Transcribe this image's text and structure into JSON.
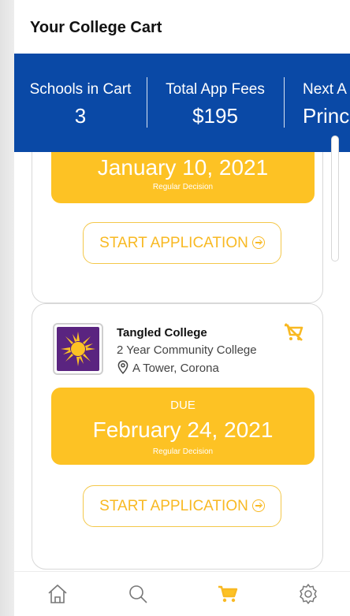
{
  "header": {
    "title": "Your College Cart"
  },
  "stats": [
    {
      "label": "Schools in Cart",
      "value": "3"
    },
    {
      "label": "Total App Fees",
      "value": "$195"
    },
    {
      "label": "Next A",
      "value": "Princ"
    }
  ],
  "cards": [
    {
      "due_date": "January 10, 2021",
      "decision": "Regular Decision",
      "button_label": "START APPLICATION"
    },
    {
      "school_name": "Tangled College",
      "school_type": "2 Year Community College",
      "location": "A Tower, Corona",
      "due_label": "DUE",
      "due_date": "February 24, 2021",
      "decision": "Regular Decision",
      "button_label": "START APPLICATION"
    }
  ],
  "colors": {
    "brand_blue": "#0a49a6",
    "accent_yellow": "#fdc224",
    "logo_purple": "#5a2480"
  },
  "icons": {
    "remove_cart": "remove-from-cart-icon",
    "location": "location-pin-icon",
    "start": "arrow-circle-right-icon",
    "nav": [
      "home-icon",
      "search-icon",
      "cart-icon",
      "settings-icon"
    ]
  },
  "nav": {
    "active": "cart"
  }
}
